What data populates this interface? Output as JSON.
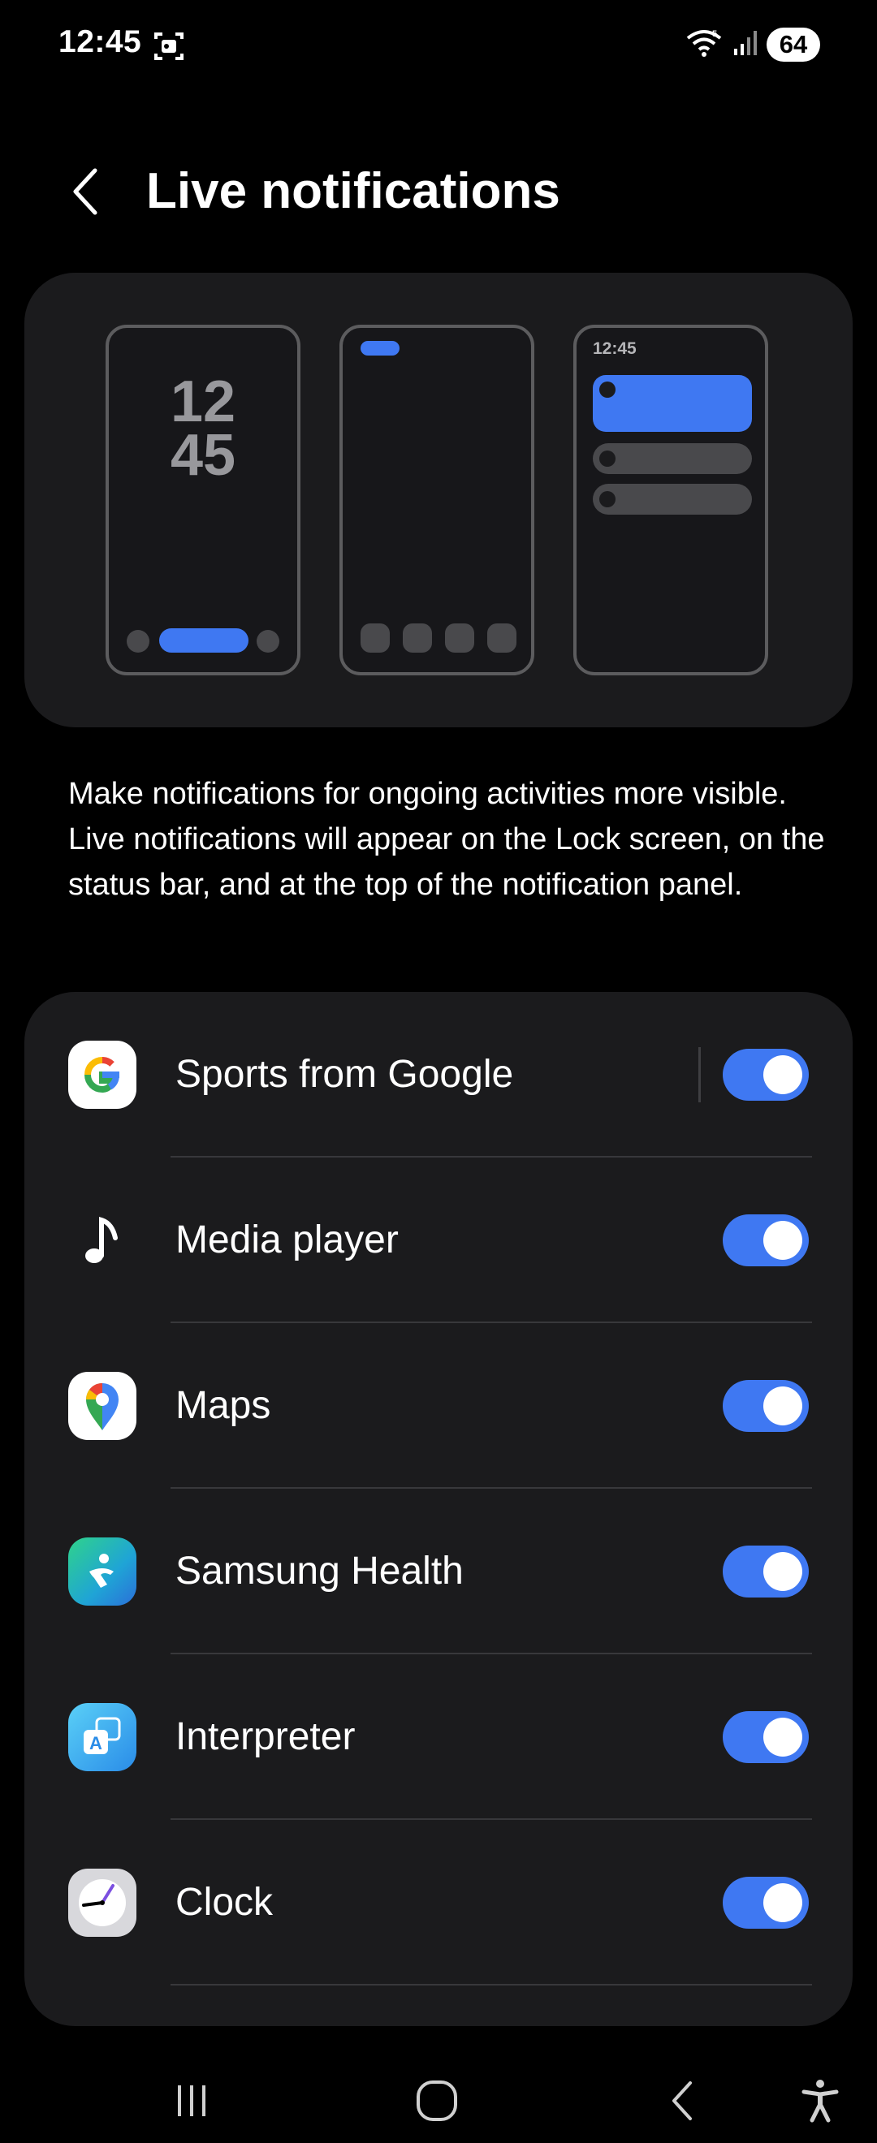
{
  "status_bar": {
    "time": "12:45",
    "battery": "64",
    "icons": [
      "screenshot-icon",
      "wifi-icon",
      "signal-icon",
      "battery-icon"
    ]
  },
  "header": {
    "title": "Live notifications",
    "back_icon": "back-arrow-icon"
  },
  "illustration": {
    "lock_clock_hours": "12",
    "lock_clock_minutes": "45",
    "panel_time": "12:45",
    "accent_color": "#3f78f2"
  },
  "description": "Make notifications for ongoing activities more visible. Live notifications will appear on the Lock screen, on the status bar, and at the top of the notification panel.",
  "apps": [
    {
      "label": "Sports from Google",
      "icon": "google-icon",
      "enabled": true
    },
    {
      "label": "Media player",
      "icon": "music-note-icon",
      "enabled": true
    },
    {
      "label": "Maps",
      "icon": "maps-icon",
      "enabled": true
    },
    {
      "label": "Samsung Health",
      "icon": "samsung-health-icon",
      "enabled": true
    },
    {
      "label": "Interpreter",
      "icon": "interpreter-icon",
      "enabled": true
    },
    {
      "label": "Clock",
      "icon": "clock-icon",
      "enabled": true
    }
  ],
  "nav_bar": {
    "buttons": [
      "recents-icon",
      "home-icon",
      "back-icon",
      "accessibility-icon"
    ]
  },
  "colors": {
    "background": "#000000",
    "card": "#1b1b1d",
    "toggle_on": "#3f78f2"
  }
}
